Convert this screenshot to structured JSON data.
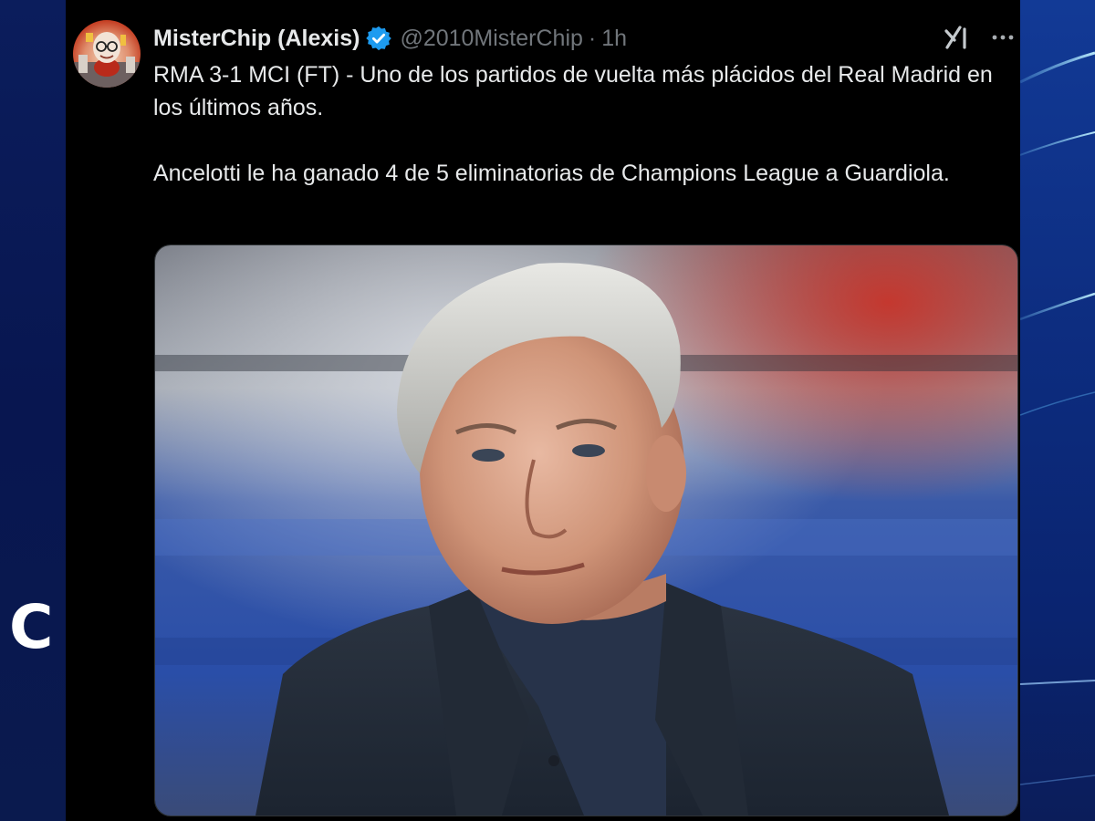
{
  "background": {
    "left_letter": "C",
    "brand_color_left": "#0b1d5c",
    "brand_color_right": "#123a96"
  },
  "tweet": {
    "author": {
      "display_name": "MisterChip (Alexis)",
      "handle": "@2010MisterChip",
      "verified": true,
      "avatar_icon": "caricature-avatar"
    },
    "separator": "·",
    "timestamp": "1h",
    "paragraphs": [
      "RMA 3-1 MCI (FT) - Uno de los partidos de vuelta más plácidos del Real Madrid en los últimos años.",
      "Ancelotti le ha ganado 4 de 5 eliminatorias de Champions League a Guardiola."
    ],
    "actions": {
      "grok_icon": "grok-icon",
      "more_icon": "more-options-icon"
    },
    "media": {
      "type": "photo",
      "description_icon": "photo-of-man-in-suit"
    },
    "colors": {
      "text": "#e7e9ea",
      "secondary": "#71767b",
      "verified": "#1d9bf0",
      "background": "#000000"
    }
  }
}
